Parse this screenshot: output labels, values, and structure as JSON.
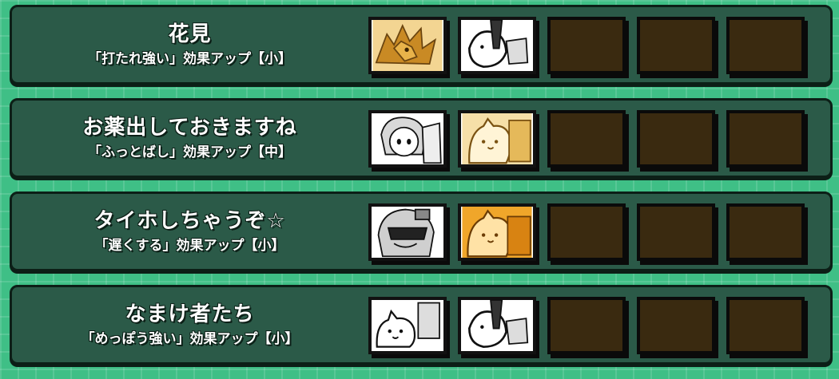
{
  "combos": [
    {
      "name": "花見",
      "effect": "「打たれ強い」効果アップ【小】",
      "slots": [
        {
          "state": "filled",
          "icon": "dragon-unit-icon",
          "tint": "gold"
        },
        {
          "state": "filled",
          "icon": "cat-with-sword-icon",
          "tint": "white"
        },
        {
          "state": "empty"
        },
        {
          "state": "empty"
        },
        {
          "state": "empty"
        }
      ]
    },
    {
      "name": "お薬出しておきますね",
      "effect": "「ふっとばし」効果アップ【中】",
      "slots": [
        {
          "state": "filled",
          "icon": "nurse-girl-icon",
          "tint": "white"
        },
        {
          "state": "filled",
          "icon": "cat-face-icon",
          "tint": "gold"
        },
        {
          "state": "empty"
        },
        {
          "state": "empty"
        },
        {
          "state": "empty"
        }
      ]
    },
    {
      "name": "タイホしちゃうぞ☆",
      "effect": "「遅くする」効果アップ【小】",
      "slots": [
        {
          "state": "filled",
          "icon": "masked-hero-icon",
          "tint": "white"
        },
        {
          "state": "filled",
          "icon": "cat-face-icon",
          "tint": "orange"
        },
        {
          "state": "empty"
        },
        {
          "state": "empty"
        },
        {
          "state": "empty"
        }
      ]
    },
    {
      "name": "なまけ者たち",
      "effect": "「めっぽう強い」効果アップ【小】",
      "slots": [
        {
          "state": "filled",
          "icon": "lazy-cat-icon",
          "tint": "white"
        },
        {
          "state": "filled",
          "icon": "cat-with-sword-icon",
          "tint": "white"
        },
        {
          "state": "empty"
        },
        {
          "state": "empty"
        },
        {
          "state": "empty"
        }
      ]
    }
  ],
  "colors": {
    "background": "#3fbf86",
    "row": "#2b5a48",
    "empty_slot": "#3a2a10",
    "gold_tint": "#d9a23a",
    "orange_tint": "#e89b1c"
  }
}
